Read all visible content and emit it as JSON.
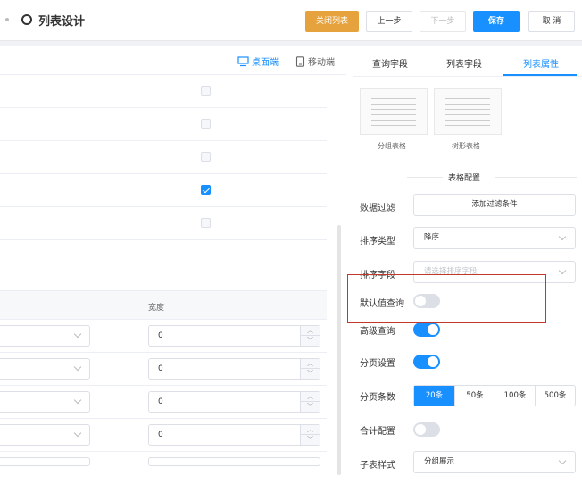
{
  "header": {
    "title": "列表设计",
    "buttons": {
      "close_list": "关闭列表",
      "prev": "上一步",
      "next": "下一步",
      "save": "保存",
      "cancel": "取 消"
    }
  },
  "device_switch": {
    "desktop": "桌面端",
    "mobile": "移动端"
  },
  "field_table": {
    "width_header": "宽度",
    "rows": [
      {
        "width": "0"
      },
      {
        "width": "0"
      },
      {
        "width": "0"
      },
      {
        "width": "0"
      }
    ]
  },
  "right_panel": {
    "tabs": [
      "查询字段",
      "列表字段",
      "列表属性"
    ],
    "active_tab": "列表属性",
    "templates": [
      "分组表格",
      "树形表格"
    ],
    "section_title": "表格配置",
    "props": {
      "filter_label": "数据过滤",
      "filter_button": "添加过滤条件",
      "sort_type_label": "排序类型",
      "sort_type_value": "降序",
      "sort_field_label": "排序字段",
      "sort_field_placeholder": "请选择排序字段",
      "default_query_label": "默认值查询",
      "advanced_query_label": "高级查询",
      "paging_label": "分页设置",
      "page_size_label": "分页条数",
      "page_size_options": [
        "20条",
        "50条",
        "100条",
        "500条"
      ],
      "page_size_selected": "20条",
      "summary_label": "合计配置",
      "subtable_style_label": "子表样式",
      "subtable_style_value": "分组展示"
    }
  },
  "colors": {
    "primary": "#1890ff",
    "warning": "#e6a23c",
    "highlight_border": "#c0392b"
  }
}
